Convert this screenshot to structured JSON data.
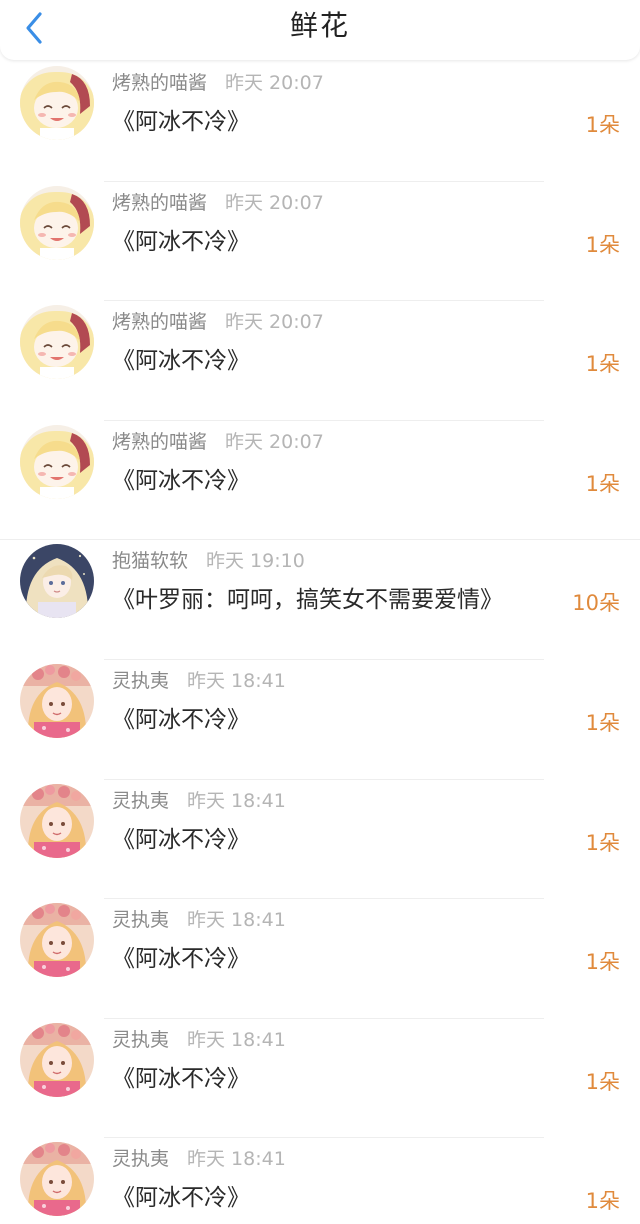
{
  "header": {
    "title": "鲜花",
    "back_icon": "chevron-left-icon",
    "accent_color": "#3a8ee6"
  },
  "colors": {
    "count": "#e08a3c",
    "username": "#8a8a8a",
    "time": "#b5b5b5"
  },
  "items": [
    {
      "user": "烤熟的喵酱",
      "time": "昨天 20:07",
      "book": "《阿冰不冷》",
      "count": "1朵",
      "avatar": "avatar-a"
    },
    {
      "user": "烤熟的喵酱",
      "time": "昨天 20:07",
      "book": "《阿冰不冷》",
      "count": "1朵",
      "avatar": "avatar-a"
    },
    {
      "user": "烤熟的喵酱",
      "time": "昨天 20:07",
      "book": "《阿冰不冷》",
      "count": "1朵",
      "avatar": "avatar-a"
    },
    {
      "user": "烤熟的喵酱",
      "time": "昨天 20:07",
      "book": "《阿冰不冷》",
      "count": "1朵",
      "avatar": "avatar-a"
    },
    {
      "user": "抱猫软软",
      "time": "昨天 19:10",
      "book": "《叶罗丽：呵呵，搞笑女不需要爱情》",
      "count": "10朵",
      "avatar": "avatar-b"
    },
    {
      "user": "灵执夷",
      "time": "昨天 18:41",
      "book": "《阿冰不冷》",
      "count": "1朵",
      "avatar": "avatar-c"
    },
    {
      "user": "灵执夷",
      "time": "昨天 18:41",
      "book": "《阿冰不冷》",
      "count": "1朵",
      "avatar": "avatar-c"
    },
    {
      "user": "灵执夷",
      "time": "昨天 18:41",
      "book": "《阿冰不冷》",
      "count": "1朵",
      "avatar": "avatar-c"
    },
    {
      "user": "灵执夷",
      "time": "昨天 18:41",
      "book": "《阿冰不冷》",
      "count": "1朵",
      "avatar": "avatar-c"
    },
    {
      "user": "灵执夷",
      "time": "昨天 18:41",
      "book": "《阿冰不冷》",
      "count": "1朵",
      "avatar": "avatar-c"
    }
  ]
}
